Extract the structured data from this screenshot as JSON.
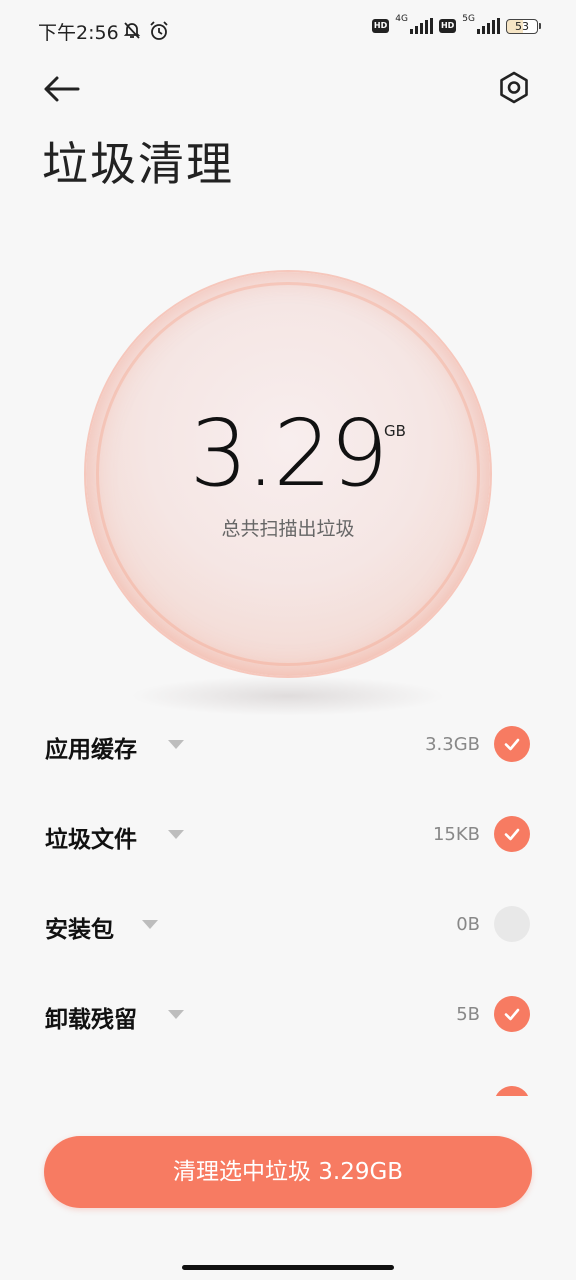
{
  "status_bar": {
    "time": "下午2:56",
    "net1": "4G",
    "net2": "5G",
    "hd": "HD",
    "battery": "53"
  },
  "header": {
    "title": "垃圾清理"
  },
  "summary": {
    "size": "3.29",
    "unit": "GB",
    "caption": "总共扫描出垃圾"
  },
  "items": [
    {
      "label": "应用缓存",
      "size": "3.3GB",
      "checked": true
    },
    {
      "label": "垃圾文件",
      "size": "15KB",
      "checked": true
    },
    {
      "label": "安装包",
      "size": "0B",
      "checked": false
    },
    {
      "label": "卸载残留",
      "size": "5B",
      "checked": true
    }
  ],
  "clean_button": {
    "label": "清理选中垃圾 3.29GB"
  },
  "colors": {
    "accent": "#f77b62",
    "unchecked": "#e8e8e8"
  }
}
